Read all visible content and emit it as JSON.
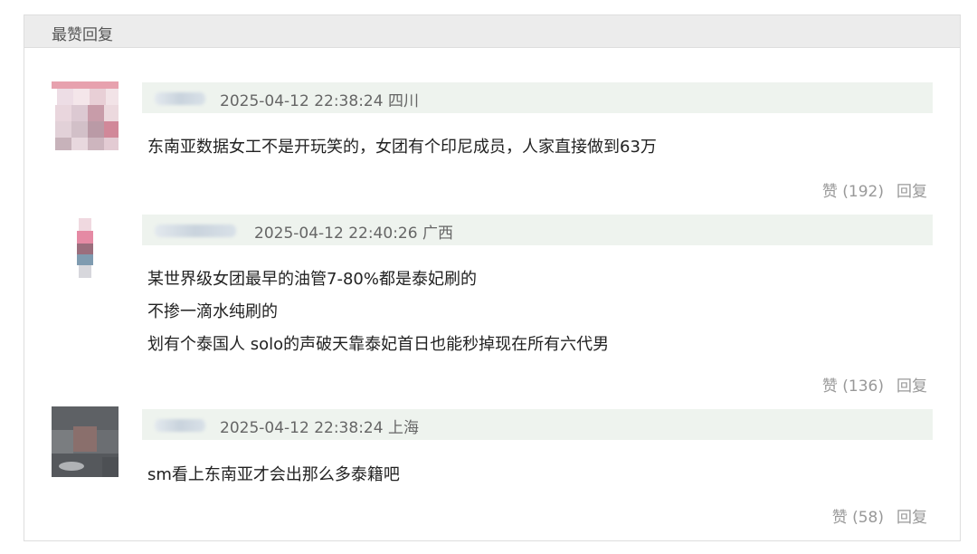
{
  "panel": {
    "title": "最赞回复"
  },
  "comments": [
    {
      "timestamp": "2025-04-12 22:38:24",
      "location": "四川",
      "lines": [
        "东南亚数据女工不是开玩笑的，女团有个印尼成员，人家直接做到63万"
      ],
      "like_label": "赞 (192)",
      "reply_label": "回复"
    },
    {
      "timestamp": "2025-04-12 22:40:26",
      "location": "广西",
      "lines": [
        "某世界级女团最早的油管7-80%都是泰妃刷的",
        "不掺一滴水纯刷的",
        "划有个泰国人 solo的声破天靠泰妃首日也能秒掉现在所有六代男"
      ],
      "like_label": "赞 (136)",
      "reply_label": "回复"
    },
    {
      "timestamp": "2025-04-12 22:38:24",
      "location": "上海",
      "lines": [
        "sm看上东南亚才会出那么多泰籍吧"
      ],
      "like_label": "赞 (58)",
      "reply_label": "回复"
    }
  ]
}
